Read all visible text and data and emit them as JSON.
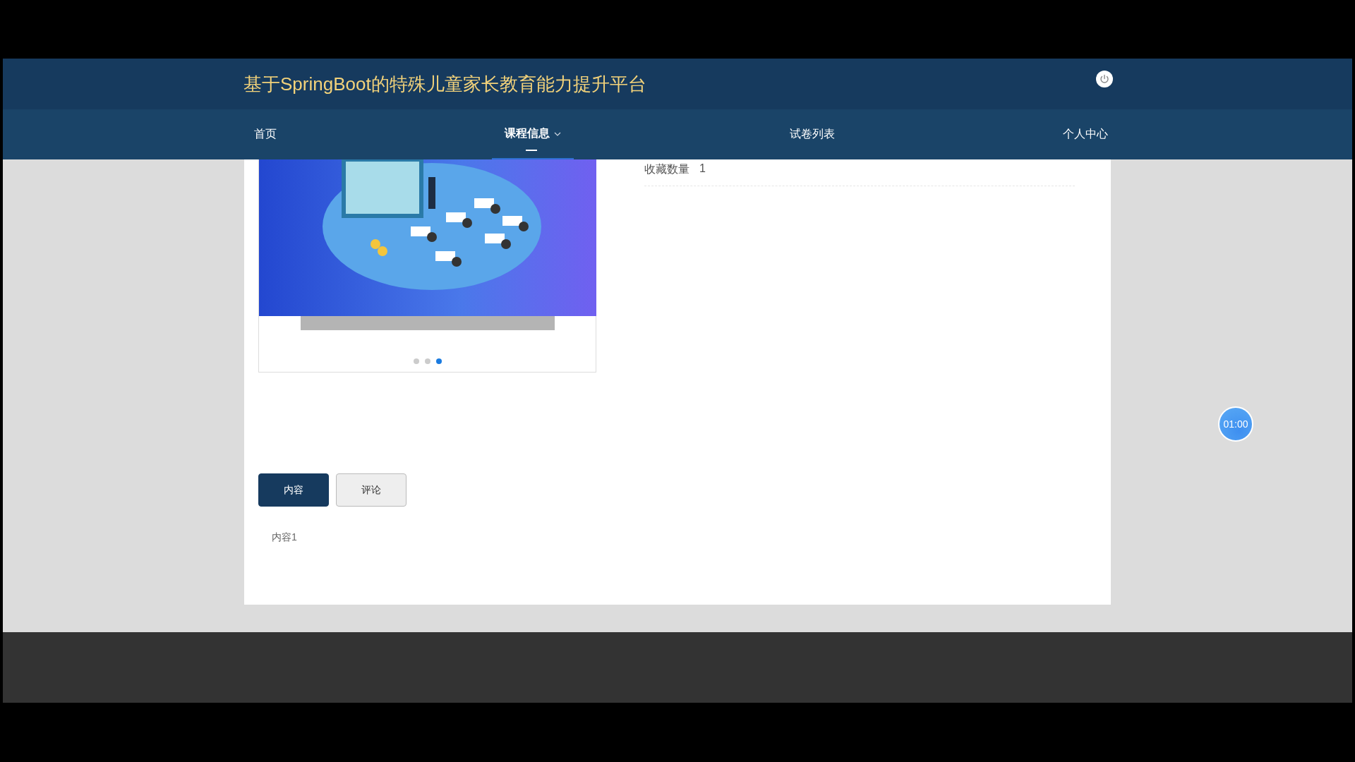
{
  "header": {
    "title": "基于SpringBoot的特殊儿童家长教育能力提升平台"
  },
  "nav": [
    {
      "label": "首页",
      "selected": false,
      "dropdown": false
    },
    {
      "label": "课程信息",
      "selected": true,
      "dropdown": true
    },
    {
      "label": "试卷列表",
      "selected": false,
      "dropdown": false
    },
    {
      "label": "个人中心",
      "selected": false,
      "dropdown": false
    }
  ],
  "carousel": {
    "dots": [
      {
        "selected": false
      },
      {
        "selected": false
      },
      {
        "selected": true
      }
    ]
  },
  "details": [
    {
      "label": "收藏数量",
      "value": "1"
    }
  ],
  "tabs": [
    {
      "label": "内容",
      "selected": true
    },
    {
      "label": "评论",
      "selected": false
    }
  ],
  "content": {
    "text": "内容1"
  },
  "timer": {
    "text": "01:00"
  }
}
